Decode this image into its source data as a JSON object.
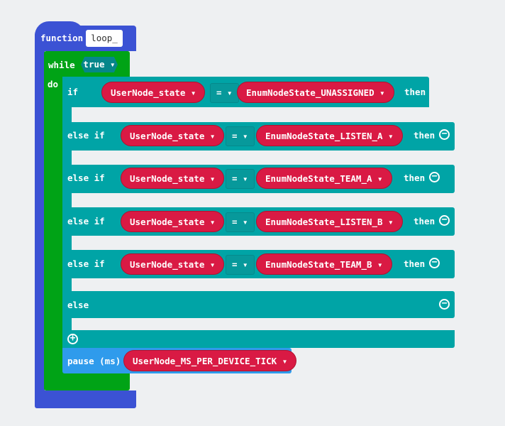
{
  "function": {
    "keyword": "function",
    "name": "loop_"
  },
  "while": {
    "keyword": "while",
    "condition": "true ▾",
    "do": "do"
  },
  "if_block": {
    "rows": [
      {
        "keyword": "if",
        "variable": "UserNode_state ▾",
        "operator": "= ▾",
        "value": "EnumNodeState_UNASSIGNED ▾",
        "then": "then"
      },
      {
        "keyword": "else if",
        "variable": "UserNode_state ▾",
        "operator": "= ▾",
        "value": "EnumNodeState_LISTEN_A ▾",
        "then": "then"
      },
      {
        "keyword": "else if",
        "variable": "UserNode_state ▾",
        "operator": "= ▾",
        "value": "EnumNodeState_TEAM_A ▾",
        "then": "then"
      },
      {
        "keyword": "else if",
        "variable": "UserNode_state ▾",
        "operator": "= ▾",
        "value": "EnumNodeState_LISTEN_B ▾",
        "then": "then"
      },
      {
        "keyword": "else if",
        "variable": "UserNode_state ▾",
        "operator": "= ▾",
        "value": "EnumNodeState_TEAM_B ▾",
        "then": "then"
      }
    ],
    "else": "else"
  },
  "pause": {
    "label": "pause (ms)",
    "value": "UserNode_MS_PER_DEVICE_TICK ▾"
  },
  "colors": {
    "function": "#3b52d4",
    "loop": "#00a316",
    "logic": "#00a4a6",
    "variable": "#d91a44",
    "basic": "#2f9bec",
    "background": "#eef0f2"
  }
}
